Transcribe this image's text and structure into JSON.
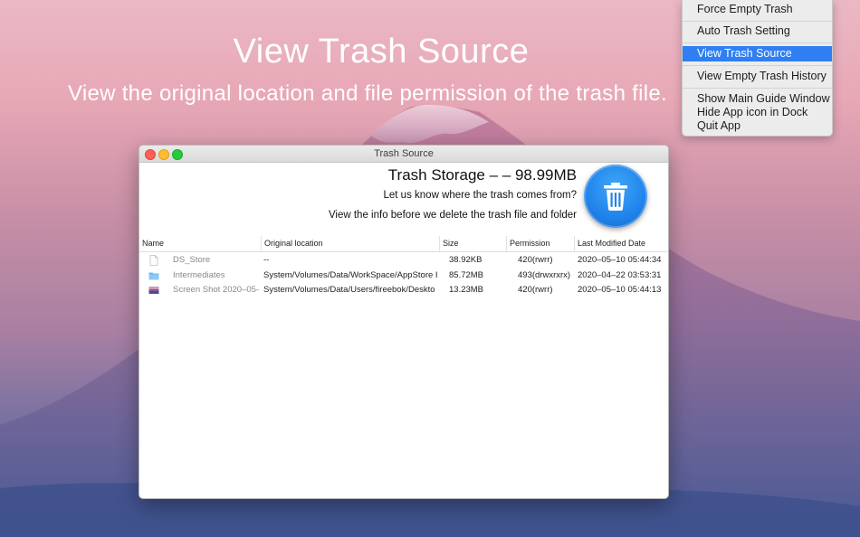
{
  "hero": {
    "title": "View Trash Source",
    "subtitle": "View the original location and file permission of the trash file."
  },
  "menu": {
    "items": [
      {
        "label": "Force Empty Trash"
      },
      {
        "label": "Auto Trash Setting"
      },
      {
        "label": "View Trash Source",
        "selected": true
      },
      {
        "label": "View Empty Trash History"
      },
      {
        "label": "Show Main Guide Window"
      },
      {
        "label": "Hide App icon in Dock"
      },
      {
        "label": "Quit App"
      }
    ]
  },
  "window": {
    "title": "Trash Source",
    "storage": "Trash Storage – – 98.99MB",
    "line1": "Let us know where the trash comes from?",
    "line2": "View the info before we delete the trash file and folder",
    "columns": [
      "Name",
      "Original location",
      "Size",
      "Permission",
      "Last Modified Date"
    ],
    "rows": [
      {
        "icon": "document-icon",
        "name": "DS_Store",
        "location": "--",
        "size": "38.92KB",
        "permission": "420(rwrr)",
        "date": "2020–05–10 05:44:34"
      },
      {
        "icon": "folder-icon",
        "name": "Intermediates",
        "location": "System/Volumes/Data/WorkSpace/AppStore I",
        "size": "85.72MB",
        "permission": "493(drwxrxrx)",
        "date": "2020–04–22 03:53:31"
      },
      {
        "icon": "image-icon",
        "name": "Screen Shot 2020–05–",
        "location": "System/Volumes/Data/Users/fireebok/Deskto",
        "size": "13.23MB",
        "permission": "420(rwrr)",
        "date": "2020–05–10 05:44:13"
      }
    ]
  },
  "colors": {
    "accent": "#2f7ff3",
    "trash_button": "#1f83eb"
  }
}
